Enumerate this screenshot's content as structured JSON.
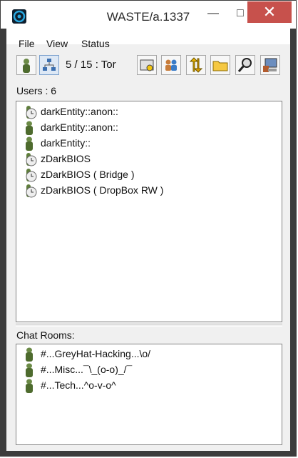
{
  "window": {
    "title": "WASTE/a.1337",
    "minimize": "—",
    "maximize": "□",
    "close": "✕"
  },
  "menu": {
    "items": [
      "File",
      "View",
      "Status"
    ]
  },
  "toolbar": {
    "status_text": "5 / 15 : Tor",
    "buttons": [
      "user-icon",
      "network-icon",
      "settings-icon",
      "users-icon",
      "transfer-icon",
      "folder-icon",
      "search-icon",
      "computer-icon"
    ]
  },
  "users": {
    "label": "Users : 6",
    "items": [
      {
        "name": "darkEntity::anon::",
        "icon": "away-user-icon"
      },
      {
        "name": "darkEntity::anon::",
        "icon": "user-icon"
      },
      {
        "name": "darkEntity::",
        "icon": "user-icon"
      },
      {
        "name": "zDarkBIOS",
        "icon": "away-user-icon"
      },
      {
        "name": "zDarkBIOS ( Bridge )",
        "icon": "away-user-icon"
      },
      {
        "name": "zDarkBIOS ( DropBox RW )",
        "icon": "away-user-icon"
      }
    ]
  },
  "chat": {
    "label": "Chat Rooms:",
    "items": [
      {
        "name": "#...GreyHat-Hacking...\\o/",
        "icon": "user-icon"
      },
      {
        "name": "#...Misc...¯\\_(o-o)_/¯",
        "icon": "user-icon"
      },
      {
        "name": "#...Tech...^o-v-o^",
        "icon": "user-icon"
      }
    ]
  }
}
